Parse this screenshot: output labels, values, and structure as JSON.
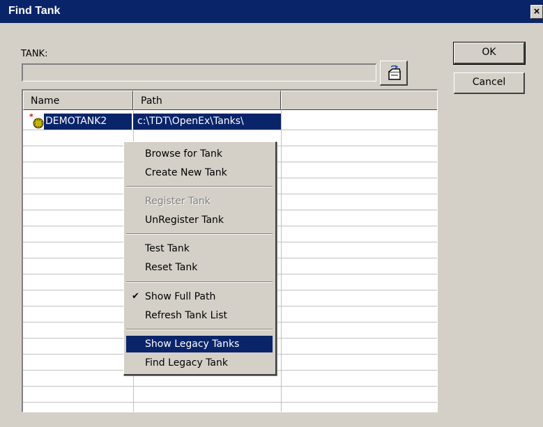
{
  "window": {
    "title": "Find Tank",
    "close_glyph": "×"
  },
  "tank_field": {
    "label": "TANK:",
    "value": ""
  },
  "buttons": {
    "ok": "OK",
    "cancel": "Cancel"
  },
  "list": {
    "columns": [
      "Name",
      "Path",
      ""
    ],
    "rows": [
      {
        "name": "DEMOTANK2",
        "path": "c:\\TDT\\OpenEx\\Tanks\\",
        "icon": "tank-icon",
        "selected": true
      }
    ]
  },
  "context_menu": {
    "items": [
      {
        "label": "Browse for Tank",
        "enabled": true
      },
      {
        "label": "Create New Tank",
        "enabled": true
      },
      {
        "label": "Register Tank",
        "enabled": false
      },
      {
        "label": "UnRegister Tank",
        "enabled": true
      },
      {
        "label": "Test Tank",
        "enabled": true
      },
      {
        "label": "Reset Tank",
        "enabled": true
      },
      {
        "label": "Show Full Path",
        "enabled": true,
        "checked": true,
        "check_glyph": "✔"
      },
      {
        "label": "Refresh Tank List",
        "enabled": true
      },
      {
        "label": "Show Legacy Tanks",
        "enabled": true,
        "highlighted": true
      },
      {
        "label": "Find Legacy Tank",
        "enabled": true
      }
    ]
  },
  "colors": {
    "face": "#d4d0c8",
    "title_bar": "#0a246a",
    "selection": "#0a246a"
  }
}
